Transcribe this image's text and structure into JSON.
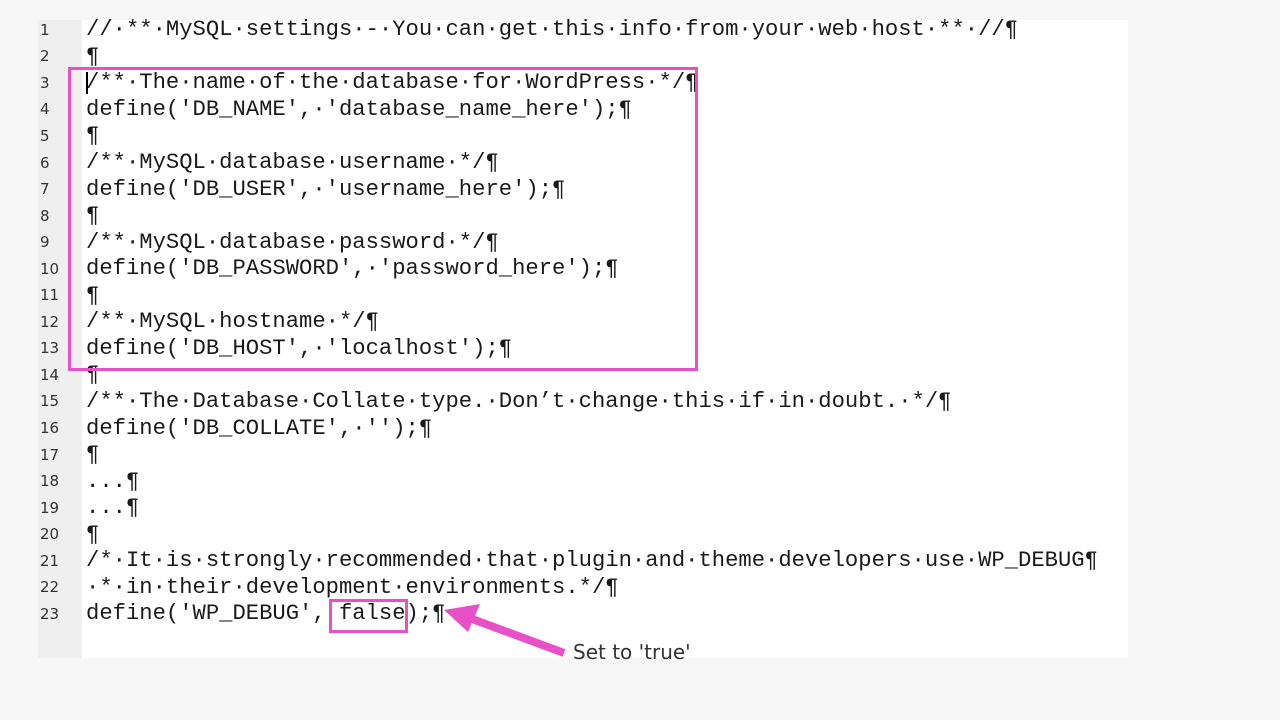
{
  "editor": {
    "lines": [
      {
        "num": "1",
        "text": "//·**·MySQL·settings·-·You·can·get·this·info·from·your·web·host·**·//¶"
      },
      {
        "num": "2",
        "text": "¶"
      },
      {
        "num": "3",
        "text": "/**·The·name·of·the·database·for·WordPress·*/¶"
      },
      {
        "num": "4",
        "text": "define('DB_NAME',·'database_name_here');¶"
      },
      {
        "num": "5",
        "text": "¶"
      },
      {
        "num": "6",
        "text": "/**·MySQL·database·username·*/¶"
      },
      {
        "num": "7",
        "text": "define('DB_USER',·'username_here');¶"
      },
      {
        "num": "8",
        "text": "¶"
      },
      {
        "num": "9",
        "text": "/**·MySQL·database·password·*/¶"
      },
      {
        "num": "10",
        "text": "define('DB_PASSWORD',·'password_here');¶"
      },
      {
        "num": "11",
        "text": "¶"
      },
      {
        "num": "12",
        "text": "/**·MySQL·hostname·*/¶"
      },
      {
        "num": "13",
        "text": "define('DB_HOST',·'localhost');¶"
      },
      {
        "num": "14",
        "text": "¶"
      },
      {
        "num": "15",
        "text": "/**·The·Database·Collate·type.·Don’t·change·this·if·in·doubt.·*/¶"
      },
      {
        "num": "16",
        "text": "define('DB_COLLATE',·'');¶"
      },
      {
        "num": "17",
        "text": "¶"
      },
      {
        "num": "18",
        "text": "...¶"
      },
      {
        "num": "19",
        "text": "...¶"
      },
      {
        "num": "20",
        "text": "¶"
      },
      {
        "num": "21",
        "text": "/*·It·is·strongly·recommended·that·plugin·and·theme·developers·use·WP_DEBUG¶"
      },
      {
        "num": "22",
        "text": "·*·in·their·development·environments.*/¶"
      },
      {
        "num": "23",
        "text": "define('WP_DEBUG', false);¶"
      }
    ],
    "cursor_line": 3
  },
  "annotations": {
    "highlight_box_lines": "3-13",
    "highlight_value": "false",
    "callout_text": "Set to 'true'",
    "accent_color": "#e850c8"
  }
}
